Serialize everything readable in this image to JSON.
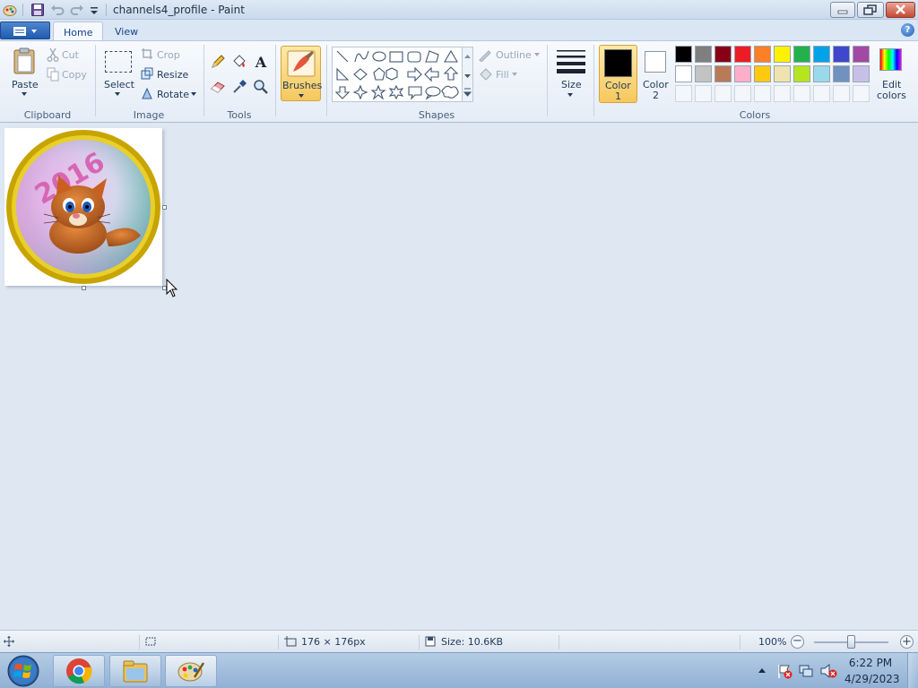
{
  "window": {
    "title": "channels4_profile - Paint"
  },
  "tabs": [
    {
      "label": "Home"
    },
    {
      "label": "View"
    }
  ],
  "clipboard": {
    "paste": "Paste",
    "cut": "Cut",
    "copy": "Copy",
    "group": "Clipboard"
  },
  "image": {
    "select": "Select",
    "crop": "Crop",
    "resize": "Resize",
    "rotate": "Rotate",
    "group": "Image"
  },
  "tools": {
    "group": "Tools"
  },
  "brushes": {
    "label": "Brushes"
  },
  "shapes": {
    "group": "Shapes",
    "outline": "Outline",
    "fill": "Fill"
  },
  "size": {
    "label": "Size"
  },
  "colors": {
    "color1": "Color",
    "color1_num": "1",
    "color2": "Color",
    "color2_num": "2",
    "edit_l1": "Edit",
    "edit_l2": "colors",
    "group": "Colors",
    "color1_value": "#000000",
    "color2_value": "#ffffff",
    "palette_row1": [
      "#000000",
      "#7f7f7f",
      "#880015",
      "#ed1c24",
      "#ff7f27",
      "#fff200",
      "#22b14c",
      "#00a2e8",
      "#3f48cc",
      "#a349a4"
    ],
    "palette_row2": [
      "#ffffff",
      "#c3c3c3",
      "#b97a57",
      "#ffaec9",
      "#ffc90e",
      "#efe4b0",
      "#b5e61d",
      "#99d9ea",
      "#7092be",
      "#c8bfe7"
    ]
  },
  "canvas_art": {
    "text": "2016"
  },
  "status": {
    "dimensions": "176 × 176px",
    "size": "Size: 10.6KB",
    "zoom": "100%"
  },
  "taskbar": {
    "time": "6:22 PM",
    "date": "4/29/2023"
  }
}
